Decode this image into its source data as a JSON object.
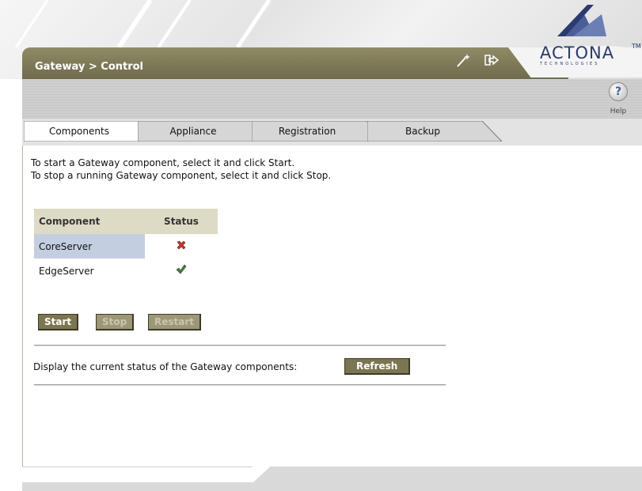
{
  "header": {
    "title": "Gateway > Control",
    "logo": {
      "text": "ACTONA",
      "tm": "TM",
      "sub": "TECHNOLOGIES"
    },
    "icons": [
      "wizard-icon",
      "logout-icon"
    ]
  },
  "toolbar": {
    "help_label": "Help"
  },
  "tabs": [
    {
      "label": "Components",
      "active": true
    },
    {
      "label": "Appliance",
      "active": false
    },
    {
      "label": "Registration",
      "active": false
    },
    {
      "label": "Backup",
      "active": false
    }
  ],
  "instructions": [
    "To start a Gateway component, select it and click Start.",
    "To stop a running Gateway component, select it and click Stop."
  ],
  "table": {
    "headers": [
      "Component",
      "Status"
    ],
    "rows": [
      {
        "name": "CoreServer",
        "status": "stopped",
        "status_icon": "x-mark-icon",
        "selected": true
      },
      {
        "name": "EdgeServer",
        "status": "running",
        "status_icon": "check-mark-icon",
        "selected": false
      }
    ]
  },
  "buttons": {
    "start": "Start",
    "stop": "Stop",
    "restart": "Restart",
    "refresh": "Refresh"
  },
  "refresh_text": "Display the current status of the Gateway components:",
  "colors": {
    "olive": "#7b7651",
    "table_header": "#dddbc5",
    "selected_row": "#c3cfe0",
    "stopped": "#c0392b",
    "running": "#4a7a3a",
    "logo": "#2b3a70"
  }
}
